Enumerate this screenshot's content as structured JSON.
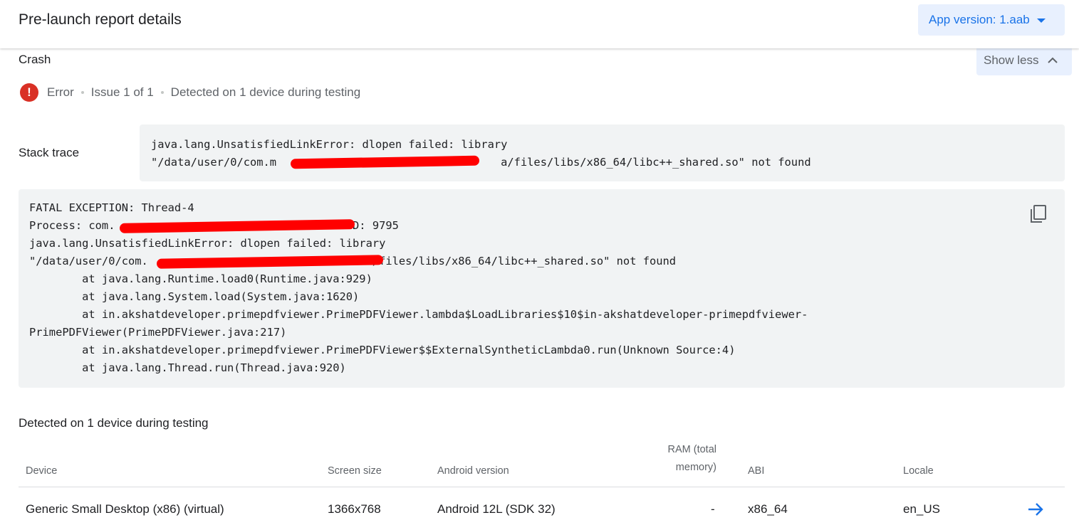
{
  "header": {
    "title": "Pre-launch report details",
    "version_button": "App version: 1.aab"
  },
  "section": {
    "title": "Crash",
    "toggle_label": "Show less"
  },
  "status": {
    "severity": "Error",
    "issue": "Issue 1 of 1",
    "detected": "Detected on 1 device during testing"
  },
  "stack_trace": {
    "label": "Stack trace",
    "line1": "java.lang.UnsatisfiedLinkError: dlopen failed: library",
    "line2": "\"/data/user/0/com.m                                  a/files/libs/x86_64/libc++_shared.so\" not found"
  },
  "trace": {
    "lines": [
      "FATAL EXCEPTION: Thread-4",
      "Process: com.                                  PID: 9795",
      "java.lang.UnsatisfiedLinkError: dlopen failed: library",
      "\"/data/user/0/com.                                  /files/libs/x86_64/libc++_shared.so\" not found",
      "        at java.lang.Runtime.load0(Runtime.java:929)",
      "        at java.lang.System.load(System.java:1620)",
      "        at in.akshatdeveloper.primepdfviewer.PrimePDFViewer.lambda$LoadLibraries$10$in-akshatdeveloper-primepdfviewer-",
      "PrimePDFViewer(PrimePDFViewer.java:217)",
      "        at in.akshatdeveloper.primepdfviewer.PrimePDFViewer$$ExternalSyntheticLambda0.run(Unknown Source:4)",
      "        at java.lang.Thread.run(Thread.java:920)"
    ]
  },
  "devices": {
    "title": "Detected on 1 device during testing",
    "columns": {
      "device": "Device",
      "screen": "Screen size",
      "android": "Android version",
      "ram_line1": "RAM (total",
      "ram_line2": "memory)",
      "abi": "ABI",
      "locale": "Locale"
    },
    "rows": [
      {
        "device": "Generic Small Desktop (x86) (virtual)",
        "screen": "1366x768",
        "android": "Android 12L (SDK 32)",
        "ram": "-",
        "abi": "x86_64",
        "locale": "en_US"
      }
    ]
  },
  "colors": {
    "accent": "#1a73e8",
    "error": "#d93025",
    "code_bg": "#f1f3f4",
    "redaction": "#ff0000"
  }
}
